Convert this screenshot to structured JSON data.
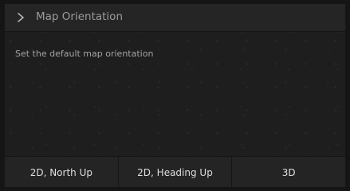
{
  "header": {
    "chevron_icon": "chevron-right-icon",
    "title": "Map Orientation"
  },
  "description": "Set the default map orientation",
  "options": [
    {
      "label": "2D, North Up"
    },
    {
      "label": "2D, Heading Up"
    },
    {
      "label": "3D"
    }
  ],
  "colors": {
    "background": "#1e1e1e",
    "header_bg": "#252525",
    "button_bar_bg": "#242424",
    "text_primary": "#dedede",
    "text_secondary": "#9b9b9b"
  }
}
